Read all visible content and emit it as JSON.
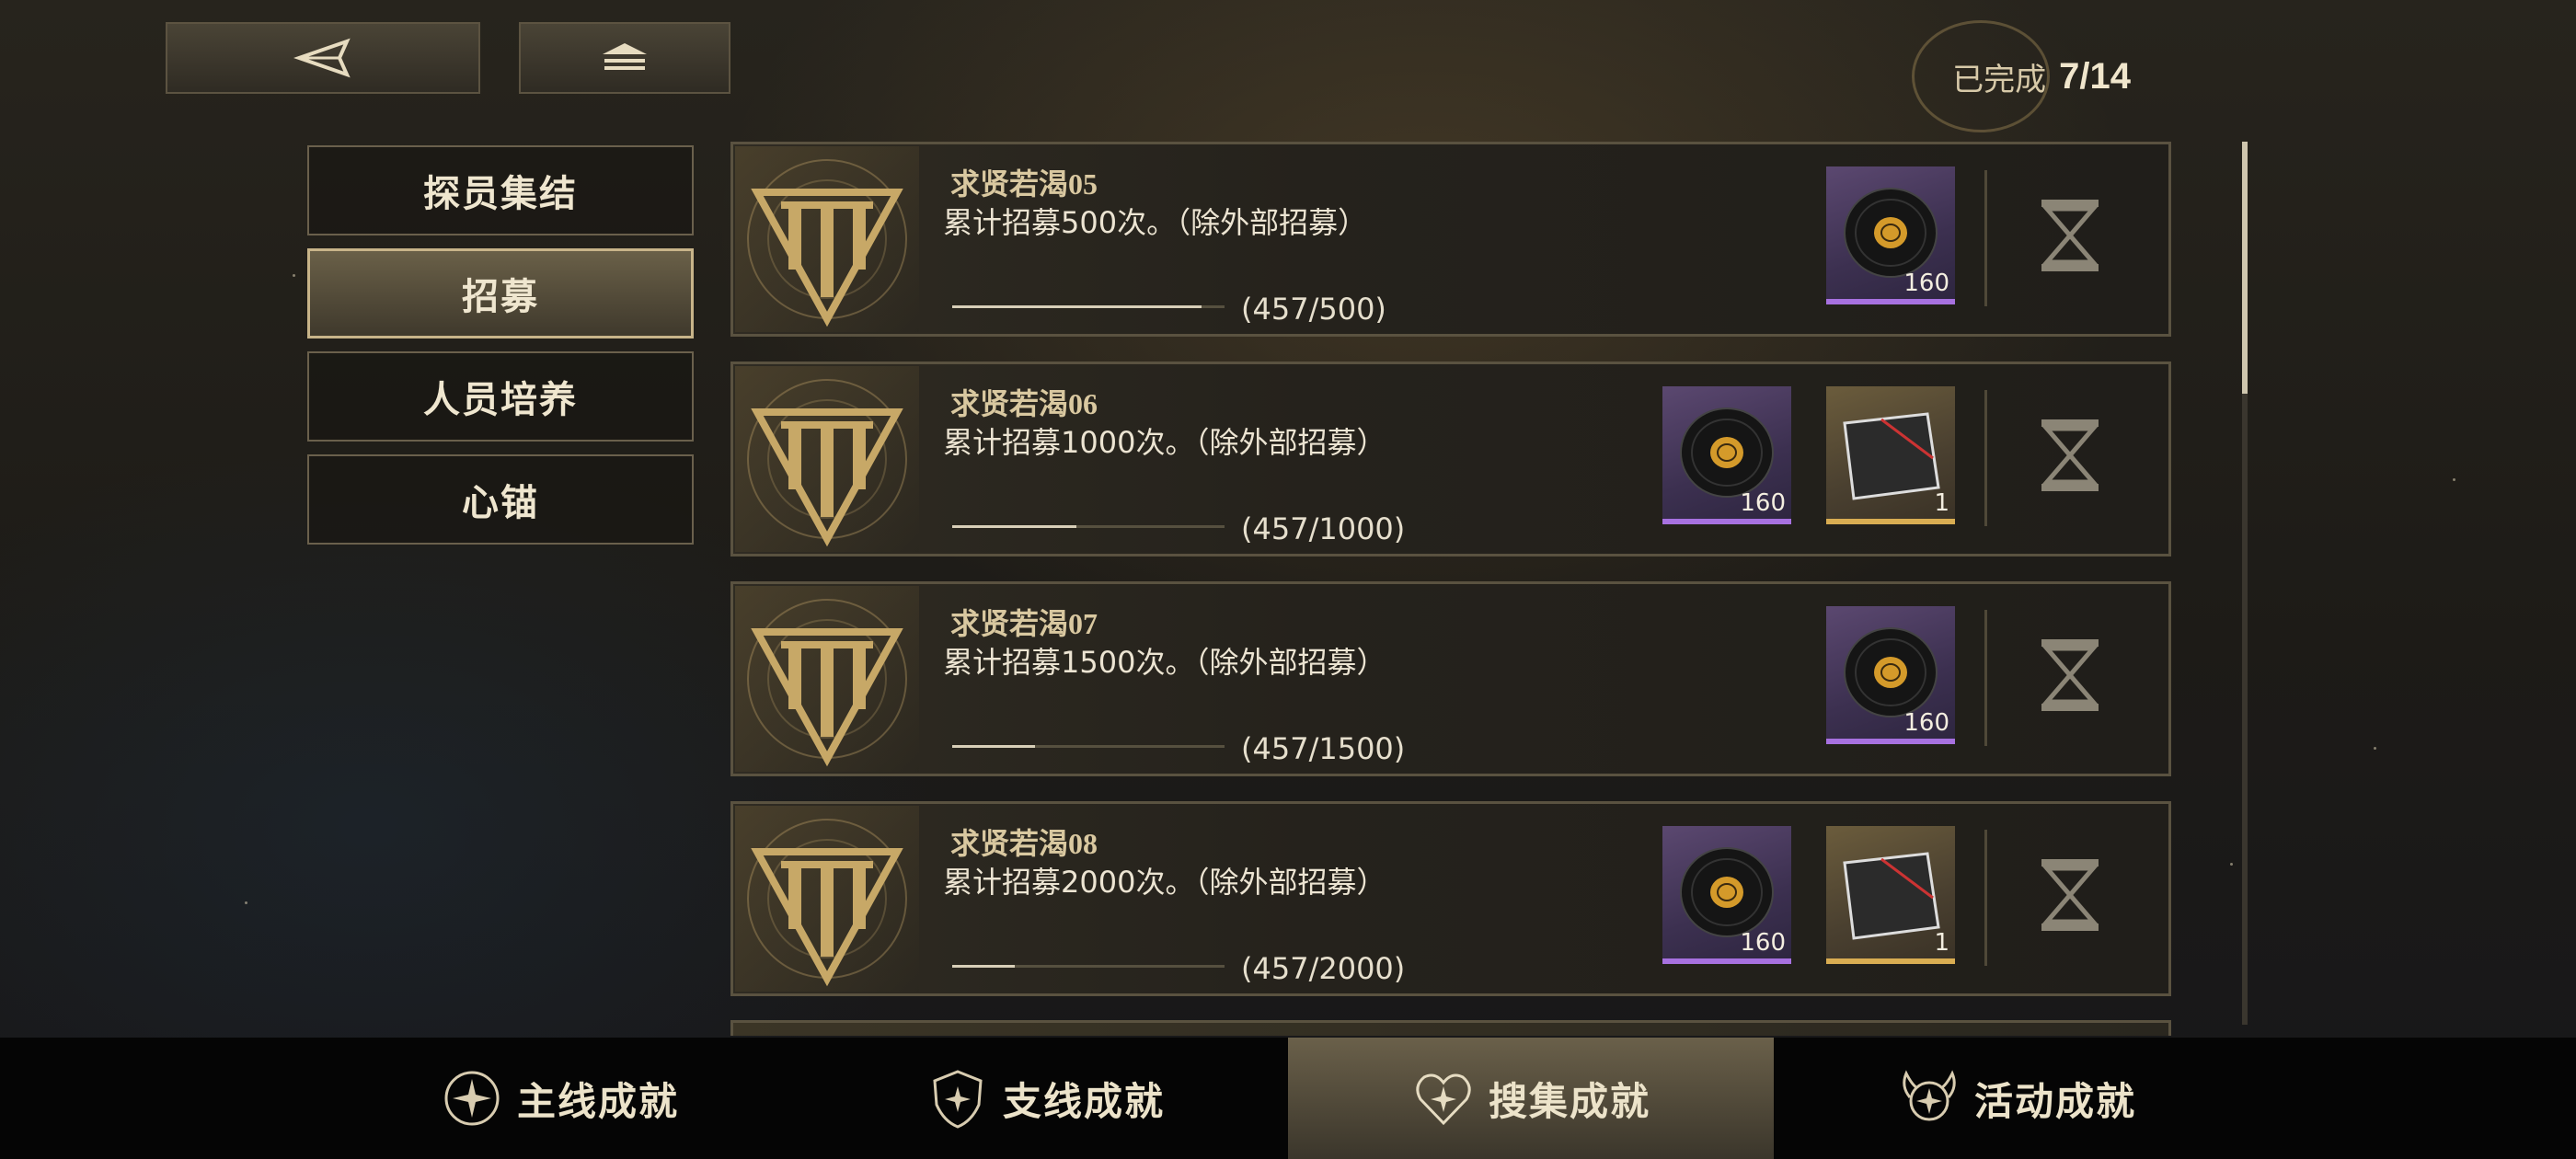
{
  "header": {
    "back_icon": "back-arrow-icon",
    "home_icon": "home-icon",
    "completed_label": "已完成",
    "completed_count": "7/14"
  },
  "categories": [
    {
      "label": "探员集结",
      "active": false
    },
    {
      "label": "招募",
      "active": true
    },
    {
      "label": "人员培养",
      "active": false
    },
    {
      "label": "心锚",
      "active": false
    }
  ],
  "achievements": [
    {
      "title": "求贤若渴05",
      "desc": "累计招募500次。（除外部招募）",
      "progress_text": "(457/500)",
      "progress_ratio": 0.914,
      "rewards": [
        {
          "icon": "vinyl-record-icon",
          "qty": "160",
          "rarity": "purple"
        }
      ],
      "status_icon": "hourglass-icon"
    },
    {
      "title": "求贤若渴06",
      "desc": "累计招募1000次。（除外部招募）",
      "progress_text": "(457/1000)",
      "progress_ratio": 0.457,
      "rewards": [
        {
          "icon": "vinyl-record-icon",
          "qty": "160",
          "rarity": "purple"
        },
        {
          "icon": "ticket-card-icon",
          "qty": "1",
          "rarity": "gold"
        }
      ],
      "status_icon": "hourglass-icon"
    },
    {
      "title": "求贤若渴07",
      "desc": "累计招募1500次。（除外部招募）",
      "progress_text": "(457/1500)",
      "progress_ratio": 0.305,
      "rewards": [
        {
          "icon": "vinyl-record-icon",
          "qty": "160",
          "rarity": "purple"
        }
      ],
      "status_icon": "hourglass-icon"
    },
    {
      "title": "求贤若渴08",
      "desc": "累计招募2000次。（除外部招募）",
      "progress_text": "(457/2000)",
      "progress_ratio": 0.229,
      "rewards": [
        {
          "icon": "vinyl-record-icon",
          "qty": "160",
          "rarity": "purple"
        },
        {
          "icon": "ticket-card-icon",
          "qty": "1",
          "rarity": "gold"
        }
      ],
      "status_icon": "hourglass-icon"
    }
  ],
  "bottom_nav": [
    {
      "label": "主线成就",
      "icon": "compass-star-icon",
      "active": false
    },
    {
      "label": "支线成就",
      "icon": "shield-star-icon",
      "active": false
    },
    {
      "label": "搜集成就",
      "icon": "heart-star-icon",
      "active": true
    },
    {
      "label": "活动成就",
      "icon": "wing-star-icon",
      "active": false
    }
  ],
  "colors": {
    "accent_gold": "#c8b489",
    "rarity_purple": "#a771e0",
    "rarity_gold": "#d9ad52"
  }
}
